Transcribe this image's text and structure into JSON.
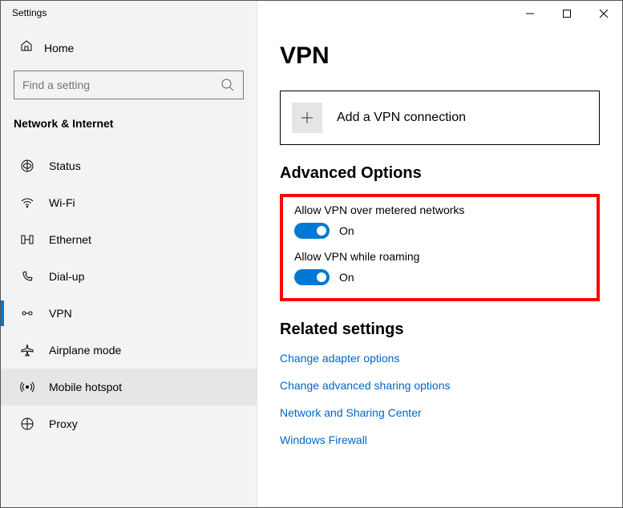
{
  "window": {
    "title": "Settings"
  },
  "home": {
    "label": "Home"
  },
  "search": {
    "placeholder": "Find a setting"
  },
  "group_header": "Network & Internet",
  "nav": [
    {
      "label": "Status"
    },
    {
      "label": "Wi-Fi"
    },
    {
      "label": "Ethernet"
    },
    {
      "label": "Dial-up"
    },
    {
      "label": "VPN"
    },
    {
      "label": "Airplane mode"
    },
    {
      "label": "Mobile hotspot"
    },
    {
      "label": "Proxy"
    }
  ],
  "page": {
    "title": "VPN"
  },
  "add_connection": {
    "label": "Add a VPN connection"
  },
  "advanced": {
    "header": "Advanced Options",
    "metered": {
      "label": "Allow VPN over metered networks",
      "state": "On"
    },
    "roaming": {
      "label": "Allow VPN while roaming",
      "state": "On"
    }
  },
  "related": {
    "header": "Related settings",
    "links": [
      "Change adapter options",
      "Change advanced sharing options",
      "Network and Sharing Center",
      "Windows Firewall"
    ]
  }
}
